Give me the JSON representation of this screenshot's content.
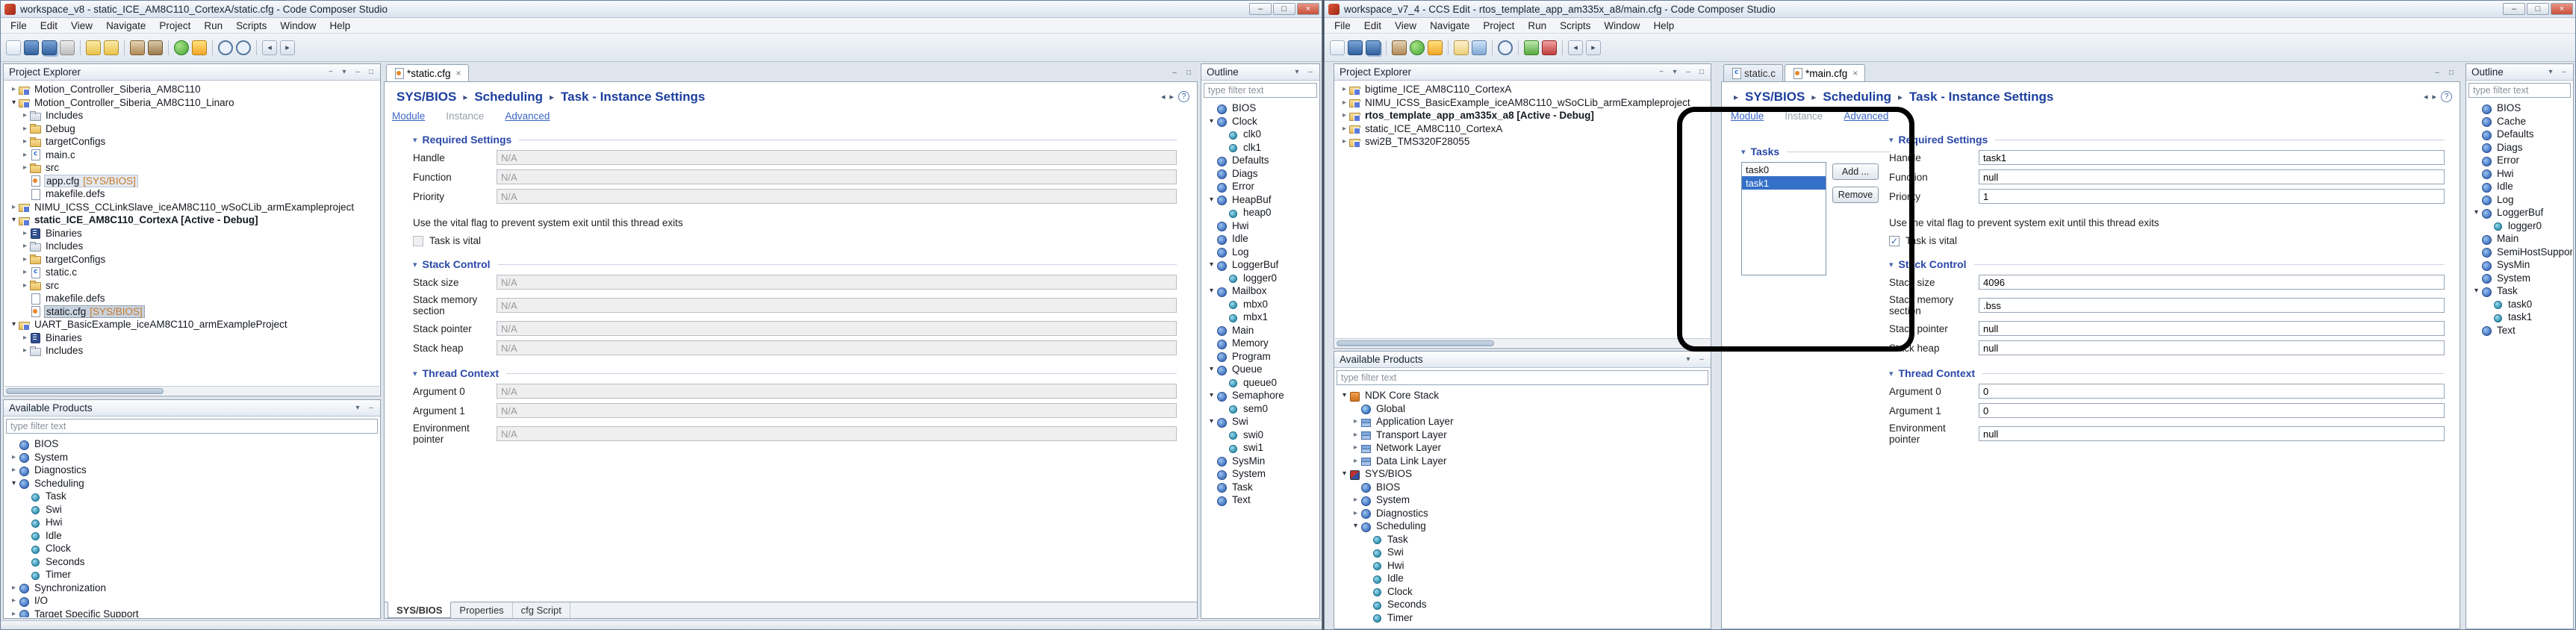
{
  "chrome": {
    "minimize": "–",
    "maximize": "□",
    "close": "×",
    "collapse": "−",
    "menu_arrow": "▾",
    "twisty_collapsed": "▸",
    "twisty_expanded": "▾",
    "crumb_sep": "▸",
    "section_twisty": "▾",
    "back": "◂",
    "forward": "▸",
    "help": "?",
    "selection_color": "#3570c8",
    "breadcrumb_color": "#1c3f9e",
    "link_color": "#3b66c4",
    "decoration_color": "#c87a2a",
    "annotation_color": "#000000"
  },
  "left": {
    "title": "workspace_v8 - static_ICE_AM8C110_CortexA/static.cfg - Code Composer Studio",
    "menu": [
      "File",
      "Edit",
      "View",
      "Navigate",
      "Project",
      "Run",
      "Scripts",
      "Window",
      "Help"
    ],
    "toolbar": [
      "new",
      "save",
      "save-all",
      "print",
      "|",
      "undo",
      "redo",
      "|",
      "build",
      "build-all",
      "|",
      "debug",
      "flash",
      "|",
      "search",
      "search-file",
      "|",
      "back",
      "forward"
    ],
    "project_explorer": {
      "title": "Project Explorer",
      "items": [
        {
          "label": "Motion_Controller_Siberia_AM8C110",
          "depth": 0,
          "tw": "c",
          "icon": "project"
        },
        {
          "label": "Motion_Controller_Siberia_AM8C110_Linaro",
          "depth": 0,
          "tw": "e",
          "icon": "project"
        },
        {
          "label": "Includes",
          "depth": 1,
          "tw": "c",
          "icon": "includes"
        },
        {
          "label": "Debug",
          "depth": 1,
          "tw": "c",
          "icon": "folder"
        },
        {
          "label": "targetConfigs",
          "depth": 1,
          "tw": "c",
          "icon": "folder"
        },
        {
          "label": "main.c",
          "depth": 1,
          "tw": "c",
          "icon": "cfile"
        },
        {
          "label": "src",
          "depth": 1,
          "tw": "c",
          "icon": "folder"
        },
        {
          "label": "app.cfg",
          "dec": "[SYS/BIOS]",
          "depth": 1,
          "tw": "n",
          "icon": "cfgfile",
          "sel": "soft"
        },
        {
          "label": "makefile.defs",
          "depth": 1,
          "tw": "n",
          "icon": "file"
        },
        {
          "label": "NIMU_ICSS_CCLinkSlave_iceAM8C110_wSoCLib_armExampleproject",
          "depth": 0,
          "tw": "c",
          "icon": "project"
        },
        {
          "label": "static_ICE_AM8C110_CortexA [Active - Debug]",
          "depth": 0,
          "tw": "e",
          "icon": "project",
          "bold": true
        },
        {
          "label": "Binaries",
          "depth": 1,
          "tw": "c",
          "icon": "binaries"
        },
        {
          "label": "Includes",
          "depth": 1,
          "tw": "c",
          "icon": "includes"
        },
        {
          "label": "targetConfigs",
          "depth": 1,
          "tw": "c",
          "icon": "folder"
        },
        {
          "label": "static.c",
          "depth": 1,
          "tw": "c",
          "icon": "cfile"
        },
        {
          "label": "src",
          "depth": 1,
          "tw": "c",
          "icon": "folder"
        },
        {
          "label": "makefile.defs",
          "depth": 1,
          "tw": "n",
          "icon": "file"
        },
        {
          "label": "static.cfg",
          "dec": "[SYS/BIOS]",
          "depth": 1,
          "tw": "n",
          "icon": "cfgfile",
          "sel": "strong"
        },
        {
          "label": "UART_BasicExample_iceAM8C110_armExampleProject",
          "depth": 0,
          "tw": "e",
          "icon": "project"
        },
        {
          "label": "Binaries",
          "depth": 1,
          "tw": "c",
          "icon": "binaries"
        },
        {
          "label": "Includes",
          "depth": 1,
          "tw": "c",
          "icon": "includes"
        }
      ]
    },
    "available_products": {
      "title": "Available Products",
      "filter_placeholder": "type filter text",
      "items": [
        {
          "label": "BIOS",
          "depth": 0,
          "tw": "n",
          "icon": "ball"
        },
        {
          "label": "System",
          "depth": 0,
          "tw": "c",
          "icon": "ball"
        },
        {
          "label": "Diagnostics",
          "depth": 0,
          "tw": "c",
          "icon": "ball"
        },
        {
          "label": "Scheduling",
          "depth": 0,
          "tw": "e",
          "icon": "ball"
        },
        {
          "label": "Task",
          "depth": 1,
          "tw": "n",
          "icon": "inst"
        },
        {
          "label": "Swi",
          "depth": 1,
          "tw": "n",
          "icon": "inst"
        },
        {
          "label": "Hwi",
          "depth": 1,
          "tw": "n",
          "icon": "inst"
        },
        {
          "label": "Idle",
          "depth": 1,
          "tw": "n",
          "icon": "inst"
        },
        {
          "label": "Clock",
          "depth": 1,
          "tw": "n",
          "icon": "inst"
        },
        {
          "label": "Seconds",
          "depth": 1,
          "tw": "n",
          "icon": "inst"
        },
        {
          "label": "Timer",
          "depth": 1,
          "tw": "n",
          "icon": "inst"
        },
        {
          "label": "Synchronization",
          "depth": 0,
          "tw": "c",
          "icon": "ball"
        },
        {
          "label": "I/O",
          "depth": 0,
          "tw": "c",
          "icon": "ball"
        },
        {
          "label": "Target Specific Support",
          "depth": 0,
          "tw": "c",
          "icon": "ball"
        }
      ]
    },
    "editor": {
      "tabs": [
        {
          "label": "*static.cfg",
          "icon": "cfgfile"
        }
      ],
      "breadcrumb": [
        "SYS/BIOS",
        "Scheduling",
        "Task - Instance Settings"
      ],
      "links": [
        {
          "label": "Module",
          "state": "link"
        },
        {
          "label": "Instance",
          "state": "current"
        },
        {
          "label": "Advanced",
          "state": "link"
        }
      ],
      "sections": {
        "required": {
          "title": "Required Settings",
          "fields": [
            {
              "label": "Handle",
              "value": "N/A"
            },
            {
              "label": "Function",
              "value": "N/A"
            },
            {
              "label": "Priority",
              "value": "N/A"
            }
          ]
        },
        "vital_text": "Use the vital flag to prevent system exit until this thread exits",
        "vital_checkbox": {
          "label": "Task is vital",
          "checked": false
        },
        "stack": {
          "title": "Stack Control",
          "fields": [
            {
              "label": "Stack size",
              "value": "N/A"
            },
            {
              "label": "Stack memory section",
              "value": "N/A"
            },
            {
              "label": "Stack pointer",
              "value": "N/A"
            },
            {
              "label": "Stack heap",
              "value": "N/A"
            }
          ]
        },
        "thread": {
          "title": "Thread Context",
          "fields": [
            {
              "label": "Argument 0",
              "value": "N/A"
            },
            {
              "label": "Argument 1",
              "value": "N/A"
            },
            {
              "label": "Environment pointer",
              "value": "N/A"
            }
          ]
        }
      },
      "bottom_tabs": [
        "SYS/BIOS",
        "Properties",
        "cfg Script"
      ]
    },
    "outline": {
      "title": "Outline",
      "filter_placeholder": "type filter text",
      "items": [
        {
          "label": "BIOS",
          "depth": 0,
          "tw": "n",
          "icon": "ball"
        },
        {
          "label": "Clock",
          "depth": 0,
          "tw": "e",
          "icon": "ball"
        },
        {
          "label": "clk0",
          "depth": 1,
          "tw": "n",
          "icon": "inst"
        },
        {
          "label": "clk1",
          "depth": 1,
          "tw": "n",
          "icon": "inst"
        },
        {
          "label": "Defaults",
          "depth": 0,
          "tw": "n",
          "icon": "ball"
        },
        {
          "label": "Diags",
          "depth": 0,
          "tw": "n",
          "icon": "ball"
        },
        {
          "label": "Error",
          "depth": 0,
          "tw": "n",
          "icon": "ball"
        },
        {
          "label": "HeapBuf",
          "depth": 0,
          "tw": "e",
          "icon": "ball"
        },
        {
          "label": "heap0",
          "depth": 1,
          "tw": "n",
          "icon": "inst"
        },
        {
          "label": "Hwi",
          "depth": 0,
          "tw": "n",
          "icon": "ball"
        },
        {
          "label": "Idle",
          "depth": 0,
          "tw": "n",
          "icon": "ball"
        },
        {
          "label": "Log",
          "depth": 0,
          "tw": "n",
          "icon": "ball"
        },
        {
          "label": "LoggerBuf",
          "depth": 0,
          "tw": "e",
          "icon": "ball"
        },
        {
          "label": "logger0",
          "depth": 1,
          "tw": "n",
          "icon": "inst"
        },
        {
          "label": "Mailbox",
          "depth": 0,
          "tw": "e",
          "icon": "ball"
        },
        {
          "label": "mbx0",
          "depth": 1,
          "tw": "n",
          "icon": "inst"
        },
        {
          "label": "mbx1",
          "depth": 1,
          "tw": "n",
          "icon": "inst"
        },
        {
          "label": "Main",
          "depth": 0,
          "tw": "n",
          "icon": "ball"
        },
        {
          "label": "Memory",
          "depth": 0,
          "tw": "n",
          "icon": "ball"
        },
        {
          "label": "Program",
          "depth": 0,
          "tw": "n",
          "icon": "ball"
        },
        {
          "label": "Queue",
          "depth": 0,
          "tw": "e",
          "icon": "ball"
        },
        {
          "label": "queue0",
          "depth": 1,
          "tw": "n",
          "icon": "inst"
        },
        {
          "label": "Semaphore",
          "depth": 0,
          "tw": "e",
          "icon": "ball"
        },
        {
          "label": "sem0",
          "depth": 1,
          "tw": "n",
          "icon": "inst"
        },
        {
          "label": "Swi",
          "depth": 0,
          "tw": "e",
          "icon": "ball"
        },
        {
          "label": "swi0",
          "depth": 1,
          "tw": "n",
          "icon": "inst"
        },
        {
          "label": "swi1",
          "depth": 1,
          "tw": "n",
          "icon": "inst"
        },
        {
          "label": "SysMin",
          "depth": 0,
          "tw": "n",
          "icon": "ball"
        },
        {
          "label": "System",
          "depth": 0,
          "tw": "n",
          "icon": "ball"
        },
        {
          "label": "Task",
          "depth": 0,
          "tw": "n",
          "icon": "ball"
        },
        {
          "label": "Text",
          "depth": 0,
          "tw": "n",
          "icon": "ball"
        }
      ]
    }
  },
  "right": {
    "title": "workspace_v7_4 - CCS Edit - rtos_template_app_am335x_a8/main.cfg - Code Composer Studio",
    "menu": [
      "File",
      "Edit",
      "View",
      "Navigate",
      "Project",
      "Run",
      "Scripts",
      "Window",
      "Help"
    ],
    "toolbar": [
      "new",
      "save",
      "save-all",
      "|",
      "build",
      "debug",
      "flash",
      "|",
      "new-project",
      "import",
      "|",
      "search",
      "|",
      "run",
      "stop",
      "|",
      "back",
      "forward"
    ],
    "project_explorer": {
      "title": "Project Explorer",
      "items": [
        {
          "label": "bigtime_ICE_AM8C110_CortexA",
          "depth": 0,
          "tw": "c",
          "icon": "project"
        },
        {
          "label": "NIMU_ICSS_BasicExample_iceAM8C110_wSoCLib_armExampleproject",
          "depth": 0,
          "tw": "c",
          "icon": "project"
        },
        {
          "label": "rtos_template_app_am335x_a8 [Active - Debug]",
          "depth": 0,
          "tw": "c",
          "icon": "project",
          "bold": true
        },
        {
          "label": "static_ICE_AM8C110_CortexA",
          "depth": 0,
          "tw": "c",
          "icon": "project"
        },
        {
          "label": "swi2B_TMS320F28055",
          "depth": 0,
          "tw": "c",
          "icon": "project"
        }
      ]
    },
    "available_products": {
      "title": "Available Products",
      "filter_placeholder": "type filter text",
      "items": [
        {
          "label": "NDK Core Stack",
          "depth": 0,
          "tw": "e",
          "icon": "ndk"
        },
        {
          "label": "Global",
          "depth": 1,
          "tw": "n",
          "icon": "globe"
        },
        {
          "label": "Application Layer",
          "depth": 1,
          "tw": "c",
          "icon": "layer"
        },
        {
          "label": "Transport Layer",
          "depth": 1,
          "tw": "c",
          "icon": "layer"
        },
        {
          "label": "Network Layer",
          "depth": 1,
          "tw": "c",
          "icon": "layer"
        },
        {
          "label": "Data Link Layer",
          "depth": 1,
          "tw": "c",
          "icon": "layer"
        },
        {
          "label": "SYS/BIOS",
          "depth": 0,
          "tw": "e",
          "icon": "sysbios"
        },
        {
          "label": "BIOS",
          "depth": 1,
          "tw": "n",
          "icon": "ball"
        },
        {
          "label": "System",
          "depth": 1,
          "tw": "c",
          "icon": "ball"
        },
        {
          "label": "Diagnostics",
          "depth": 1,
          "tw": "c",
          "icon": "ball"
        },
        {
          "label": "Scheduling",
          "depth": 1,
          "tw": "e",
          "icon": "ball"
        },
        {
          "label": "Task",
          "depth": 2,
          "tw": "n",
          "icon": "inst"
        },
        {
          "label": "Swi",
          "depth": 2,
          "tw": "n",
          "icon": "inst"
        },
        {
          "label": "Hwi",
          "depth": 2,
          "tw": "n",
          "icon": "inst"
        },
        {
          "label": "Idle",
          "depth": 2,
          "tw": "n",
          "icon": "inst"
        },
        {
          "label": "Clock",
          "depth": 2,
          "tw": "n",
          "icon": "inst"
        },
        {
          "label": "Seconds",
          "depth": 2,
          "tw": "n",
          "icon": "inst"
        },
        {
          "label": "Timer",
          "depth": 2,
          "tw": "n",
          "icon": "inst"
        }
      ]
    },
    "editor": {
      "tabs": [
        {
          "label": "static.c",
          "icon": "cfile"
        },
        {
          "label": "*main.cfg",
          "icon": "cfgfile"
        }
      ],
      "breadcrumb": [
        "SYS/BIOS",
        "Scheduling",
        "Task - Instance Settings"
      ],
      "links": [
        {
          "label": "Module",
          "state": "link"
        },
        {
          "label": "Instance",
          "state": "current"
        },
        {
          "label": "Advanced",
          "state": "link"
        }
      ],
      "tasks": {
        "title": "Tasks",
        "items": [
          "task0",
          "task1"
        ],
        "selected_index": 1,
        "add_label": "Add ...",
        "remove_label": "Remove"
      },
      "sections": {
        "required": {
          "title": "Required Settings",
          "fields": [
            {
              "label": "Handle",
              "value": "task1"
            },
            {
              "label": "Function",
              "value": "null"
            },
            {
              "label": "Priority",
              "value": "1"
            }
          ]
        },
        "vital_text": "Use the vital flag to prevent system exit until this thread exits",
        "vital_checkbox": {
          "label": "Task is vital",
          "checked": true
        },
        "stack": {
          "title": "Stack Control",
          "fields": [
            {
              "label": "Stack size",
              "value": "4096"
            },
            {
              "label": "Stack memory section",
              "value": ".bss"
            },
            {
              "label": "Stack pointer",
              "value": "null"
            },
            {
              "label": "Stack heap",
              "value": "null"
            }
          ]
        },
        "thread": {
          "title": "Thread Context",
          "fields": [
            {
              "label": "Argument 0",
              "value": "0"
            },
            {
              "label": "Argument 1",
              "value": "0"
            },
            {
              "label": "Environment pointer",
              "value": "null"
            }
          ]
        }
      }
    },
    "outline": {
      "title": "Outline",
      "filter_placeholder": "type filter text",
      "items": [
        {
          "label": "BIOS",
          "depth": 0,
          "tw": "n",
          "icon": "ball"
        },
        {
          "label": "Cache",
          "depth": 0,
          "tw": "n",
          "icon": "ball"
        },
        {
          "label": "Defaults",
          "depth": 0,
          "tw": "n",
          "icon": "ball"
        },
        {
          "label": "Diags",
          "depth": 0,
          "tw": "n",
          "icon": "ball"
        },
        {
          "label": "Error",
          "depth": 0,
          "tw": "n",
          "icon": "ball"
        },
        {
          "label": "Hwi",
          "depth": 0,
          "tw": "n",
          "icon": "ball"
        },
        {
          "label": "Idle",
          "depth": 0,
          "tw": "n",
          "icon": "ball"
        },
        {
          "label": "Log",
          "depth": 0,
          "tw": "n",
          "icon": "ball"
        },
        {
          "label": "LoggerBuf",
          "depth": 0,
          "tw": "e",
          "icon": "ball"
        },
        {
          "label": "logger0",
          "depth": 1,
          "tw": "n",
          "icon": "inst"
        },
        {
          "label": "Main",
          "depth": 0,
          "tw": "n",
          "icon": "ball"
        },
        {
          "label": "SemiHostSupport",
          "depth": 0,
          "tw": "n",
          "icon": "ball"
        },
        {
          "label": "SysMin",
          "depth": 0,
          "tw": "n",
          "icon": "ball"
        },
        {
          "label": "System",
          "depth": 0,
          "tw": "n",
          "icon": "ball"
        },
        {
          "label": "Task",
          "depth": 0,
          "tw": "e",
          "icon": "ball"
        },
        {
          "label": "task0",
          "depth": 1,
          "tw": "n",
          "icon": "inst"
        },
        {
          "label": "task1",
          "depth": 1,
          "tw": "n",
          "icon": "inst"
        },
        {
          "label": "Text",
          "depth": 0,
          "tw": "n",
          "icon": "ball"
        }
      ]
    }
  }
}
